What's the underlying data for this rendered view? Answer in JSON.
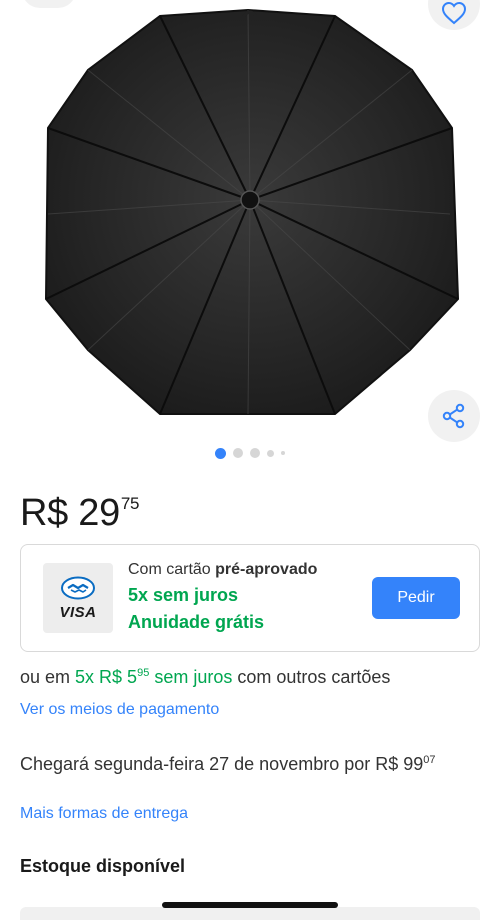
{
  "icons": {
    "favorite": "heart-icon",
    "share": "share-icon",
    "card_brand": "mercado-pago-handshake-icon"
  },
  "colors": {
    "accent": "#3483fa",
    "success": "#00a650",
    "text": "#333333"
  },
  "gallery": {
    "image_alt": "Guarda-chuva preto",
    "dots_total": 5,
    "active_dot": 1
  },
  "price": {
    "main": "R$ 29",
    "cents": "75"
  },
  "card_offer": {
    "line1_prefix": "Com cartão ",
    "line1_bold": "pré-aprovado",
    "line2": "5x sem juros",
    "line3": "Anuidade grátis",
    "brand_text": "VISA",
    "button_label": "Pedir"
  },
  "installments": {
    "prefix": "ou em ",
    "highlight": "5x R$ 5",
    "cents": "95",
    "suffix_green": " sem juros",
    "suffix": " com outros cartões"
  },
  "payment_link": "Ver os meios de pagamento",
  "delivery": {
    "text": "Chegará segunda-feira 27 de novembro por R$ 99",
    "cents": "07",
    "link": "Mais formas de entrega"
  },
  "stock": {
    "label": "Estoque disponível"
  }
}
